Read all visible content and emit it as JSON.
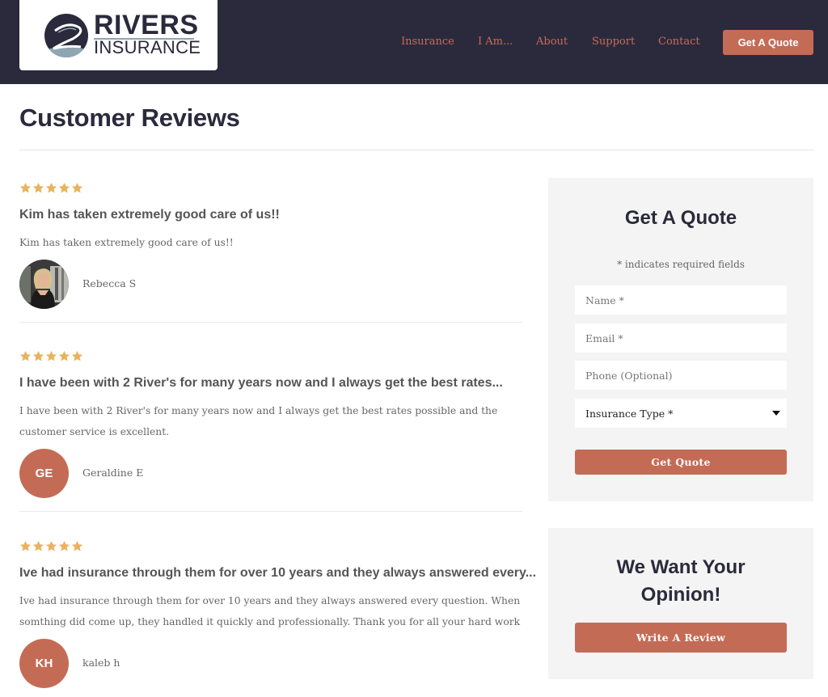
{
  "brand": {
    "logo_line1": "RIVERS",
    "logo_line2": "INSURANCE",
    "accent_color": "#c46b56",
    "header_color": "#2b2a3d",
    "star_color": "#e8b35e"
  },
  "nav": {
    "items": [
      {
        "label": "Insurance"
      },
      {
        "label": "I Am..."
      },
      {
        "label": "About"
      },
      {
        "label": "Support"
      },
      {
        "label": "Contact"
      }
    ],
    "cta_label": "Get A Quote"
  },
  "page": {
    "title": "Customer Reviews"
  },
  "reviews": [
    {
      "rating": 5,
      "title": "Kim has taken extremely good care of us!!",
      "body": "Kim has taken extremely good care of us!!",
      "reviewer": "Rebecca S",
      "avatar_type": "photo",
      "initials": ""
    },
    {
      "rating": 5,
      "title": "I have been with 2 River's for many years now and I always get the best rates...",
      "body": "I have been with 2 River's for many years now and I always get the best rates possible and the customer service is excellent.",
      "reviewer": "Geraldine E",
      "avatar_type": "initials",
      "initials": "GE"
    },
    {
      "rating": 5,
      "title": "Ive had insurance through them for over 10 years and they always answered every...",
      "body": "Ive had insurance through them for over 10 years and they always answered every question. When somthing did come up, they handled it quickly and professionally. Thank you for all your hard work",
      "reviewer": "kaleb h",
      "avatar_type": "initials",
      "initials": "KH"
    }
  ],
  "quote_form": {
    "title": "Get A Quote",
    "required_note": "* indicates required fields",
    "name_placeholder": "Name *",
    "email_placeholder": "Email *",
    "phone_placeholder": "Phone (Optional)",
    "insurance_type_selected": "Insurance Type *",
    "submit_label": "Get Quote"
  },
  "opinion": {
    "title_line1": "We Want Your",
    "title_line2": "Opinion!",
    "button_label": "Write A Review"
  }
}
